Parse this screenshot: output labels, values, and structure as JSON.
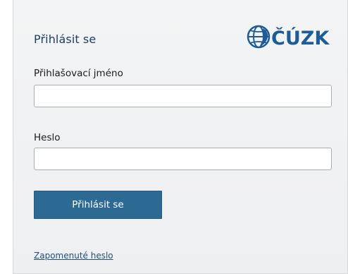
{
  "login": {
    "title": "Přihlásit se",
    "logo_text": "ČÚZK",
    "username_label": "Přihlašovací jméno",
    "username_value": "",
    "password_label": "Heslo",
    "password_value": "",
    "submit_label": "Přihlásit se",
    "forgot_password_link": "Zapomenuté heslo"
  },
  "colors": {
    "accent": "#2d6a93",
    "title": "#1f3d61",
    "logo": "#1d5c96",
    "panel_bg": "#f1f2f4"
  },
  "icons": {
    "logo": "cuzk-globe-logo"
  }
}
